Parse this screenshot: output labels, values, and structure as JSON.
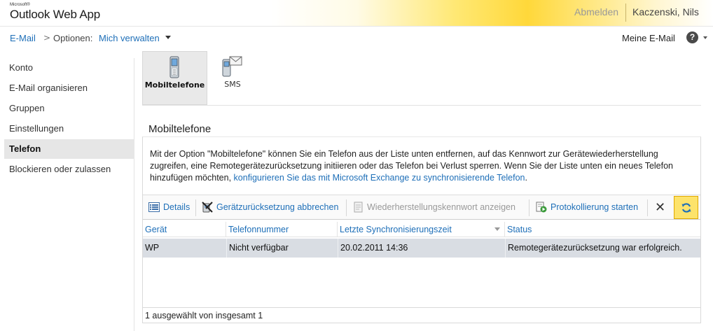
{
  "header": {
    "logo_small": "Microsoft®",
    "logo_main": "Outlook Web App",
    "signout_label": "Abmelden",
    "username": "Kaczenski, Nils"
  },
  "breadcrumb": {
    "email_link": "E-Mail",
    "separator": ">",
    "options_label": "Optionen:",
    "manage_link": "Mich verwalten"
  },
  "topright": {
    "my_mail": "Meine E-Mail",
    "help_glyph": "?"
  },
  "sidebar": {
    "items": [
      {
        "label": "Konto",
        "active": false
      },
      {
        "label": "E-Mail organisieren",
        "active": false
      },
      {
        "label": "Gruppen",
        "active": false
      },
      {
        "label": "Einstellungen",
        "active": false
      },
      {
        "label": "Telefon",
        "active": true
      },
      {
        "label": "Blockieren oder zulassen",
        "active": false
      }
    ]
  },
  "tabs": [
    {
      "label": "Mobiltelefone",
      "icon": "mobile-phone-icon",
      "active": true
    },
    {
      "label": "SMS",
      "icon": "sms-icon",
      "active": false
    }
  ],
  "main": {
    "title": "Mobiltelefone",
    "description": "Mit der Option \"Mobiltelefone\" können Sie ein Telefon aus der Liste unten entfernen, auf das Kennwort zur Gerätewiederherstellung zugreifen, eine Remotegerätezurücksetzung initiieren oder das Telefon bei Verlust sperren. Wenn Sie der Liste unten ein neues Telefon hinzufügen möchten,",
    "description_link": "konfigurieren Sie das mit Microsoft Exchange zu synchronisierende Telefon",
    "description_end": "."
  },
  "toolbar": {
    "details": "Details",
    "cancel_wipe": "Gerätzurücksetzung abbrechen",
    "show_recovery_password": "Wiederherstellungskennwort anzeigen",
    "start_logging": "Protokollierung starten",
    "delete_glyph": "✕",
    "refresh_glyph": "↻"
  },
  "grid": {
    "columns": [
      "Gerät",
      "Telefonnummer",
      "Letzte Synchronisierungszeit",
      "Status"
    ],
    "rows": [
      [
        "WP",
        "Nicht verfügbar",
        "20.02.2011 14:36",
        "Remotegerätezurücksetzung war erfolgreich."
      ]
    ],
    "footer": "1 ausgewählt von insgesamt 1"
  },
  "colors": {
    "link": "#1e6fb8",
    "selected_row": "#d9dde3",
    "active_nav": "#e6e6e6",
    "refresh_highlight": "#fde36b"
  }
}
